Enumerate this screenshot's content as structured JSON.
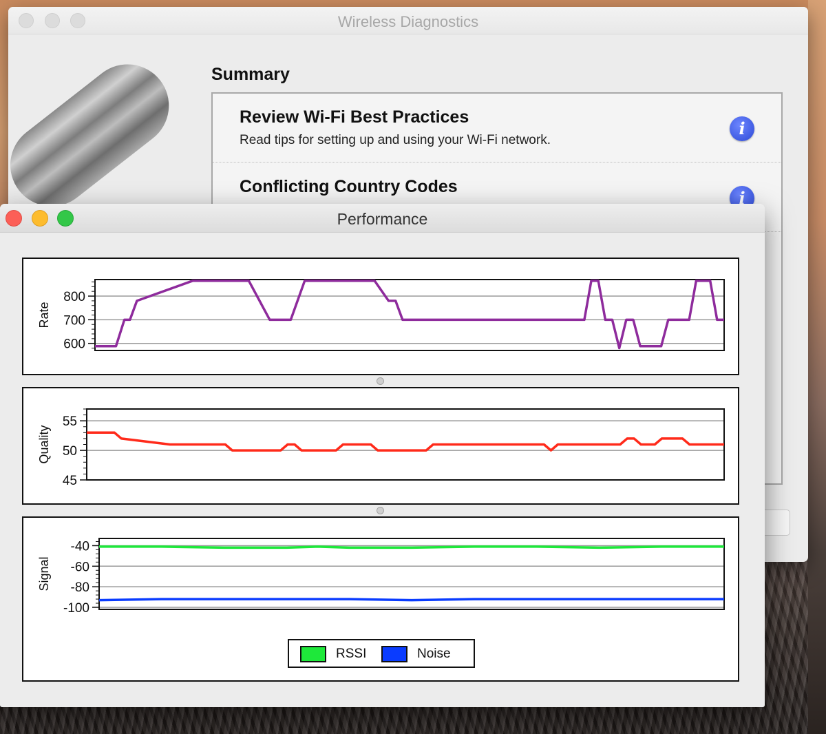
{
  "back_window": {
    "title": "Wireless Diagnostics",
    "summary_heading": "Summary",
    "items": [
      {
        "title": "Review Wi-Fi Best Practices",
        "description": "Read tips for setting up and using your Wi-Fi network.",
        "icon": "info-icon"
      },
      {
        "title": "Conflicting Country Codes",
        "description": "",
        "icon": "info-icon"
      }
    ]
  },
  "performance_window": {
    "title": "Performance",
    "colors": {
      "rate": "#8e2b9c",
      "quality": "#ff2a1a",
      "rssi": "#1ee83a",
      "noise": "#0a3cff"
    }
  },
  "chart_data": [
    {
      "type": "line",
      "ylabel": "Rate",
      "ylim": [
        570,
        870
      ],
      "yticks": [
        600,
        700,
        800
      ],
      "x": [
        0,
        2,
        3,
        4.2,
        5,
        6,
        14,
        22,
        25,
        28,
        30,
        40,
        42,
        43,
        44,
        70,
        71,
        72,
        73,
        74,
        75,
        76,
        77,
        78,
        80,
        81,
        82,
        84,
        85,
        86,
        87,
        88,
        89,
        90
      ],
      "series": [
        {
          "values": [
            588,
            588,
            588,
            700,
            700,
            780,
            865,
            865,
            700,
            700,
            865,
            865,
            780,
            780,
            700,
            700,
            865,
            865,
            700,
            700,
            580,
            700,
            700,
            588,
            588,
            588,
            700,
            700,
            700,
            865,
            865,
            865,
            700,
            700
          ]
        }
      ]
    },
    {
      "type": "line",
      "ylabel": "Quality",
      "ylim": [
        45,
        57
      ],
      "yticks": [
        45,
        50,
        55
      ],
      "x": [
        0,
        4,
        5,
        12,
        20,
        21,
        28,
        29,
        30,
        31,
        36,
        37,
        41,
        42,
        49,
        50,
        66,
        67,
        68,
        77,
        78,
        79,
        80,
        82,
        83,
        86,
        87,
        92
      ],
      "series": [
        {
          "values": [
            53,
            53,
            52,
            51,
            51,
            50,
            50,
            51,
            51,
            50,
            50,
            51,
            51,
            50,
            50,
            51,
            51,
            50,
            51,
            51,
            52,
            52,
            51,
            51,
            52,
            52,
            51,
            51
          ]
        }
      ]
    },
    {
      "type": "line",
      "ylabel": "Signal",
      "ylim": [
        -102,
        -33
      ],
      "yticks": [
        -40,
        -60,
        -80,
        -100
      ],
      "x": [
        0,
        10,
        20,
        30,
        35,
        40,
        50,
        60,
        70,
        80,
        90,
        100
      ],
      "series": [
        {
          "name": "RSSI",
          "values": [
            -41,
            -41,
            -42,
            -42,
            -41,
            -42,
            -42,
            -41,
            -41,
            -42,
            -41,
            -41
          ]
        },
        {
          "name": "Noise",
          "values": [
            -93,
            -92,
            -92,
            -92,
            -92,
            -92,
            -93,
            -92,
            -92,
            -92,
            -92,
            -92
          ]
        }
      ],
      "legend": {
        "position": "bottom-center",
        "entries": [
          "RSSI",
          "Noise"
        ]
      }
    }
  ]
}
